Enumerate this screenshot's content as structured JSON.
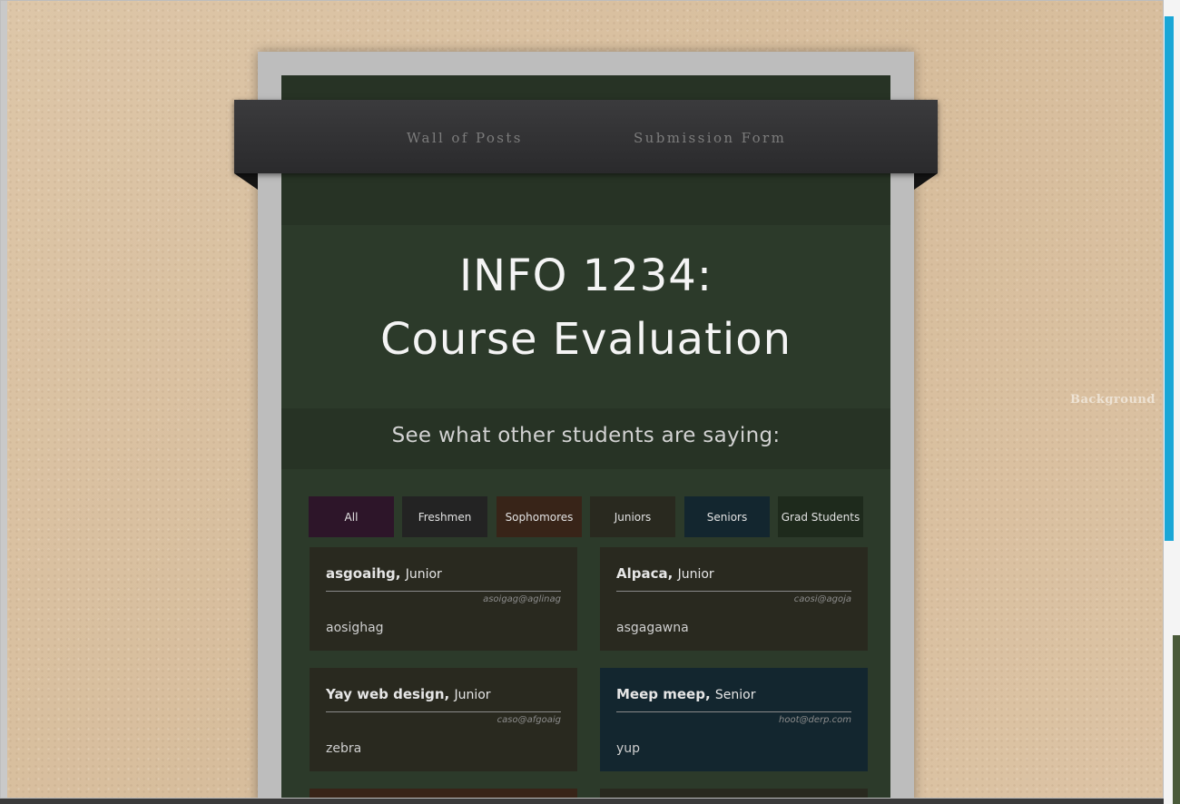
{
  "nav": {
    "wall_label": "Wall of Posts",
    "form_label": "Submission Form"
  },
  "header": {
    "title_line1": "INFO 1234:",
    "title_line2": "Course Evaluation",
    "subtitle": "See what other students are saying:"
  },
  "filters": [
    {
      "label": "All",
      "color": "#2d1529"
    },
    {
      "label": "Freshmen",
      "color": "#232323"
    },
    {
      "label": "Sophomores",
      "color": "#382418"
    },
    {
      "label": "Juniors",
      "color": "#29291f"
    },
    {
      "label": "Seniors",
      "color": "#13262f"
    },
    {
      "label": "Grad Students",
      "color": "#1e2a1c"
    }
  ],
  "posts": [
    {
      "name": "asgoaihg,",
      "year": "Junior",
      "email": "asoigag@aglinag",
      "comment": "aosighag",
      "color": "#29291f"
    },
    {
      "name": "Alpaca,",
      "year": "Junior",
      "email": "caosi@agoja",
      "comment": "asgagawna",
      "color": "#29291f"
    },
    {
      "name": "Yay web design,",
      "year": "Junior",
      "email": "caso@afgoaig",
      "comment": "zebra",
      "color": "#29291f"
    },
    {
      "name": "Meep meep,",
      "year": "Senior",
      "email": "hoot@derp.com",
      "comment": "yup",
      "color": "#13262f"
    }
  ],
  "background_label": "Background"
}
